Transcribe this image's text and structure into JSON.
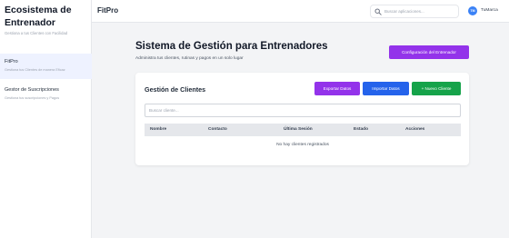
{
  "sidebar": {
    "title": "Ecosistema de Entrenador",
    "subtitle": "Gestiona a tus Clientes con Facilidad",
    "items": [
      {
        "label": "FitPro",
        "description": "Gestiona tus Clientes de manera Eficaz",
        "active": true
      },
      {
        "label": "Gestor de Suscripciones",
        "description": "Gestiona tus suscripciones y Pagos",
        "active": false
      }
    ]
  },
  "header": {
    "brand": "FitPro",
    "search_placeholder": "Buscar aplicaciones...",
    "user": {
      "initials": "TM",
      "name": "TuMarca"
    }
  },
  "main": {
    "title": "Sistema de Gestión para Entrenadores",
    "subtitle": "Administra tus clientes, rutinas y pagos en un solo lugar",
    "config_button": "Configuración del Entrenador",
    "card": {
      "title": "Gestión de Clientes",
      "export_button": "Exportar Datos",
      "import_button": "Importar Datos",
      "new_button": "+ Nuevo Cliente",
      "filter_placeholder": "Buscar cliente...",
      "columns": [
        "Nombre",
        "Contacto",
        "Última Sesión",
        "Estado",
        "Acciones"
      ],
      "empty_message": "No hay clientes registrados"
    }
  },
  "colors": {
    "purple": "#9333ea",
    "blue": "#2563eb",
    "green": "#16a34a",
    "avatar": "#3b82f6"
  }
}
